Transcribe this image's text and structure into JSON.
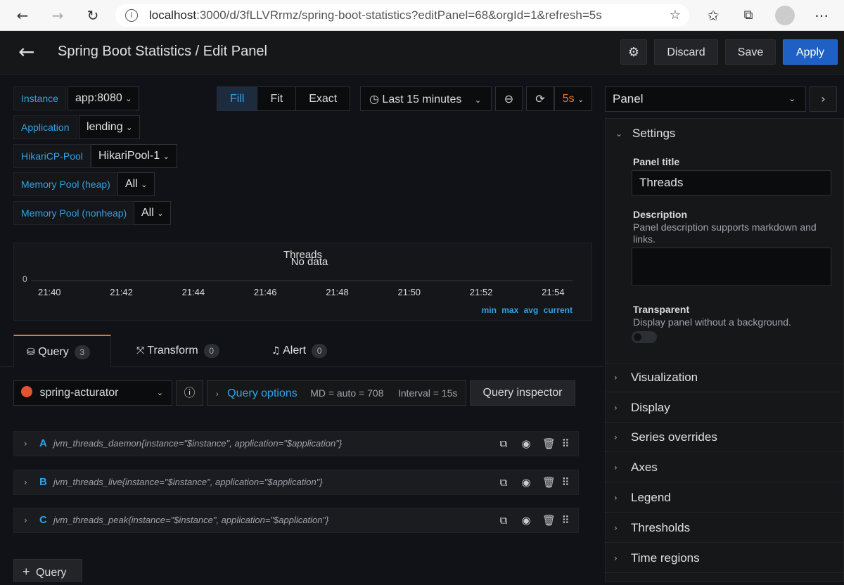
{
  "browser": {
    "url_host": "localhost",
    "url_rest": ":3000/d/3fLLVRrmz/spring-boot-statistics?editPanel=68&orgId=1&refresh=5s"
  },
  "header": {
    "title": "Spring Boot Statistics / Edit Panel",
    "discard": "Discard",
    "save": "Save",
    "apply": "Apply"
  },
  "variables": [
    {
      "label": "Instance",
      "value": "app:8080"
    },
    {
      "label": "Application",
      "value": "lending"
    },
    {
      "label": "HikariCP-Pool",
      "value": "HikariPool-1"
    },
    {
      "label": "Memory Pool (heap)",
      "value": "All"
    },
    {
      "label": "Memory Pool (nonheap)",
      "value": "All"
    }
  ],
  "view_modes": [
    "Fill",
    "Fit",
    "Exact"
  ],
  "time_range": "Last 15 minutes",
  "refresh": "5s",
  "panel": {
    "title": "Threads",
    "no_data": "No data",
    "y_tick": "0",
    "x_ticks": [
      "21:40",
      "21:42",
      "21:44",
      "21:46",
      "21:48",
      "21:50",
      "21:52",
      "21:54"
    ],
    "legend": [
      "min",
      "max",
      "avg",
      "current"
    ]
  },
  "tabs": [
    {
      "label": "Query",
      "count": "3"
    },
    {
      "label": "Transform",
      "count": "0"
    },
    {
      "label": "Alert",
      "count": "0"
    }
  ],
  "query_bar": {
    "datasource": "spring-acturator",
    "options_label": "Query options",
    "md": "MD = auto = 708",
    "interval": "Interval = 15s",
    "inspector": "Query inspector"
  },
  "queries": [
    {
      "letter": "A",
      "expr": "jvm_threads_daemon{instance=\"$instance\", application=\"$application\"}"
    },
    {
      "letter": "B",
      "expr": "jvm_threads_live{instance=\"$instance\", application=\"$application\"}"
    },
    {
      "letter": "C",
      "expr": "jvm_threads_peak{instance=\"$instance\", application=\"$application\"}"
    }
  ],
  "add_query": "Query",
  "sidebar": {
    "selector": "Panel",
    "settings": "Settings",
    "panel_title_label": "Panel title",
    "panel_title_value": "Threads",
    "description_label": "Description",
    "description_hint": "Panel description supports markdown and links.",
    "transparent_label": "Transparent",
    "transparent_hint": "Display panel without a background.",
    "sections": [
      "Visualization",
      "Display",
      "Series overrides",
      "Axes",
      "Legend",
      "Thresholds",
      "Time regions"
    ]
  },
  "colors": {
    "accent": "#33a2e5",
    "apply": "#1f60c4",
    "refresh": "#eb7b18"
  }
}
